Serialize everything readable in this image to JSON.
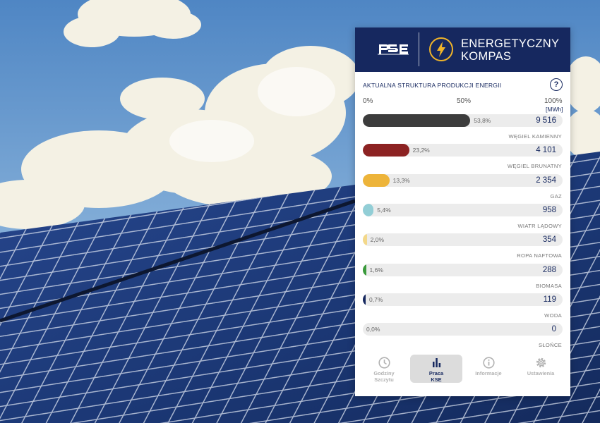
{
  "header": {
    "title_line1": "ENERGETYCZNY",
    "title_line2": "KOMPAS",
    "brand": "PSE"
  },
  "section": {
    "title": "AKTUALNA STRUKTURA PRODUKCJI ENERGII",
    "help": "?"
  },
  "scale": {
    "left": "0%",
    "middle": "50%",
    "right": "100%",
    "unit": "[MWh]"
  },
  "rows": [
    {
      "label": "WĘGIEL KAMIENNY",
      "pct_text": "53,8%",
      "pct": 53.8,
      "value": "9 516",
      "color": "#3c3c3c"
    },
    {
      "label": "WĘGIEL BRUNATNY",
      "pct_text": "23,2%",
      "pct": 23.2,
      "value": "4 101",
      "color": "#8c2222"
    },
    {
      "label": "GAZ",
      "pct_text": "13,3%",
      "pct": 13.3,
      "value": "2 354",
      "color": "#edb43a"
    },
    {
      "label": "WIATR LĄDOWY",
      "pct_text": "5,4%",
      "pct": 5.4,
      "value": "958",
      "color": "#92ced6"
    },
    {
      "label": "ROPA NAFTOWA",
      "pct_text": "2,0%",
      "pct": 2.0,
      "value": "354",
      "color": "#f3d88a"
    },
    {
      "label": "BIOMASA",
      "pct_text": "1,6%",
      "pct": 1.6,
      "value": "288",
      "color": "#3a9a3c"
    },
    {
      "label": "WODA",
      "pct_text": "0,7%",
      "pct": 0.7,
      "value": "119",
      "color": "#16285f"
    },
    {
      "label": "SŁOŃCE",
      "pct_text": "0,0%",
      "pct": 0.0,
      "value": "0",
      "color": "#f0c000"
    }
  ],
  "nav": {
    "items": [
      {
        "line1": "Godziny",
        "line2": "Szczytu",
        "icon": "clock-icon",
        "active": false
      },
      {
        "line1": "Praca",
        "line2": "KSE",
        "icon": "bar-chart-icon",
        "active": true
      },
      {
        "line1": "Informacje",
        "line2": "",
        "icon": "info-icon",
        "active": false
      },
      {
        "line1": "Ustawienia",
        "line2": "",
        "icon": "gear-icon",
        "active": false
      }
    ]
  }
}
